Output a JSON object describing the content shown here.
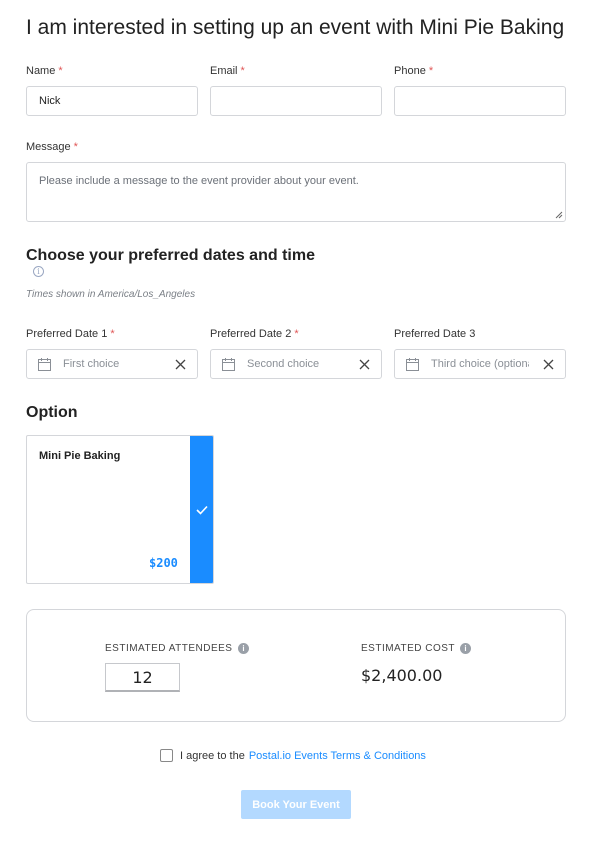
{
  "title": "I am interested in setting up an event with Mini Pie Baking",
  "contact": {
    "name_label": "Name",
    "name_value": "Nick",
    "email_label": "Email",
    "email_value": "",
    "phone_label": "Phone",
    "phone_value": "",
    "required_mark": "*"
  },
  "message": {
    "label": "Message",
    "placeholder": "Please include a message to the event provider about your event."
  },
  "dates": {
    "heading": "Choose your preferred dates and time",
    "info_icon": "info-circle-icon",
    "timezone_note": "Times shown in America/Los_Angeles",
    "fields": [
      {
        "label": "Preferred Date 1",
        "required": true,
        "placeholder": "First choice"
      },
      {
        "label": "Preferred Date 2",
        "required": true,
        "placeholder": "Second choice"
      },
      {
        "label": "Preferred Date 3",
        "required": false,
        "placeholder": "Third choice (optional)"
      }
    ]
  },
  "option": {
    "heading": "Option",
    "card": {
      "name": "Mini Pie Baking",
      "price": "$200",
      "selected": true
    }
  },
  "estimate": {
    "attendees_label": "ESTIMATED ATTENDEES",
    "attendees_value": "12",
    "cost_label": "ESTIMATED COST",
    "cost_value": "$2,400.00"
  },
  "agreement": {
    "text": "I agree to the",
    "link": "Postal.io Events Terms & Conditions",
    "checked": false
  },
  "submit": {
    "label": "Book Your Event"
  },
  "colors": {
    "accent": "#1a8cff",
    "required": "#e05555",
    "button_disabled": "#b3d9ff"
  }
}
